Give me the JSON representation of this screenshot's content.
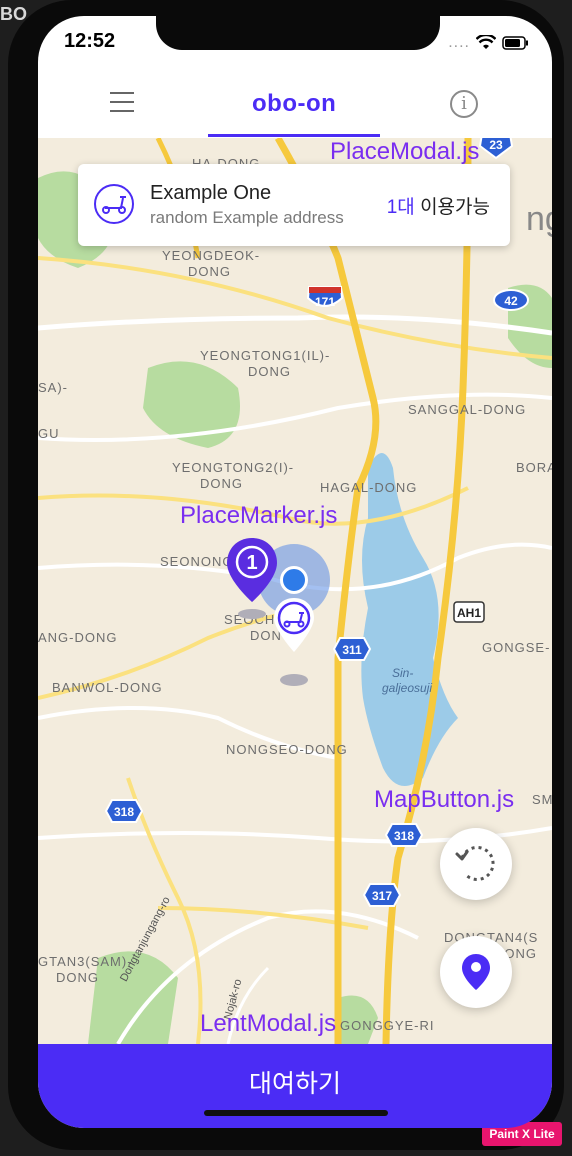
{
  "page_fragment": "BO",
  "status_bar": {
    "time": "12:52",
    "signal": "....",
    "icons": [
      "location-arrow-icon",
      "wifi-icon",
      "battery-icon"
    ]
  },
  "header": {
    "logo": "obo-on",
    "menu_icon": "hamburger-icon",
    "info_icon": "info-icon",
    "info_glyph": "i"
  },
  "place_modal": {
    "name": "Example One",
    "address": "random Example address",
    "count": "1대",
    "status": "이용가능"
  },
  "map": {
    "labels": [
      "HA-DONG",
      "YEONGDEOK-",
      "DONG",
      "YEONGTONG1(IL)-",
      "DONG",
      "SANGGAL-DONG",
      "YEONGTONG2(I)-",
      "DONG",
      "HAGAL-DONG",
      "BORA",
      "SEONONG",
      "SEOCH",
      "DON",
      "GONGSE-",
      "ANG-DONG",
      "BANWOL-DONG",
      "NONGSEO-DONG",
      "SMA",
      "DONGTAN4(S",
      "DONG",
      "GTAN3(SAM)-",
      "DONG",
      "Dongtanjungang-ro",
      "Nojak-ro",
      "GONGGYE-RI",
      "GU",
      "SA)-",
      "ng",
      "Sin-",
      "galjeosuji"
    ],
    "shields": [
      "23",
      "171",
      "42",
      "AH1",
      "311",
      "318",
      "318",
      "317"
    ],
    "marker_count": "1"
  },
  "annotations": {
    "place_modal": "PlaceModal.js",
    "place_marker": "PlaceMarker.js",
    "map_button": "MapButton.js",
    "lent_modal": "LentModal.js"
  },
  "buttons": {
    "refresh_icon": "refresh-icon",
    "location_icon": "location-pin-icon"
  },
  "bottom_button": {
    "label": "대여하기"
  },
  "watermark": "Paint X Lite",
  "colors": {
    "primary": "#4b2cf5",
    "annotation": "#7a2ef0",
    "map_bg": "#f3ecdd",
    "water": "#9ccbe8",
    "park": "#b7dca0",
    "highway": "#f6c93d"
  }
}
